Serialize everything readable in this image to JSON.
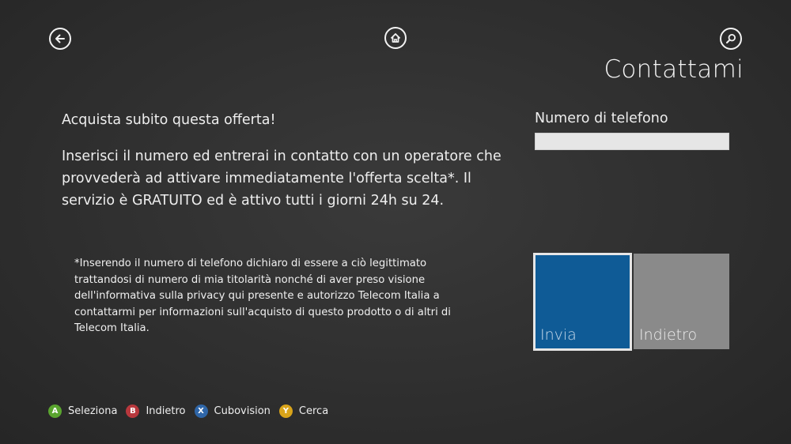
{
  "nav": {
    "back_icon": "back-arrow-icon",
    "home_icon": "home-icon",
    "search_icon": "search-icon"
  },
  "page": {
    "title": "Contattami"
  },
  "content": {
    "headline": "Acquista subito questa offerta!",
    "body": "Inserisci il numero ed entrerai in contatto con un operatore che provvederà ad attivare immediatamente l'offerta scelta*. Il servizio è GRATUITO ed è attivo tutti i giorni 24h su 24.",
    "disclaimer": "*Inserendo il numero di telefono dichiaro di essere a ciò legittimato trattandosi di numero di mia titolarità nonché di aver preso visione dell'informativa sulla privacy qui presente e autorizzo Telecom Italia a contattarmi per informazioni sull'acquisto di questo prodotto o di altri di Telecom Italia."
  },
  "form": {
    "phone_label": "Numero di telefono",
    "phone_value": "",
    "send_label": "Invia",
    "back_label": "Indietro"
  },
  "colors": {
    "send_tile": "#0f5b96",
    "back_tile": "#8a8a8a",
    "button_a": "#5aa52f",
    "button_b": "#b8383d",
    "button_x": "#2f66a8",
    "button_y": "#d9a41a"
  },
  "legend": {
    "items": [
      {
        "key": "A",
        "label": "Seleziona"
      },
      {
        "key": "B",
        "label": "Indietro"
      },
      {
        "key": "X",
        "label": "Cubovision"
      },
      {
        "key": "Y",
        "label": "Cerca"
      }
    ]
  }
}
